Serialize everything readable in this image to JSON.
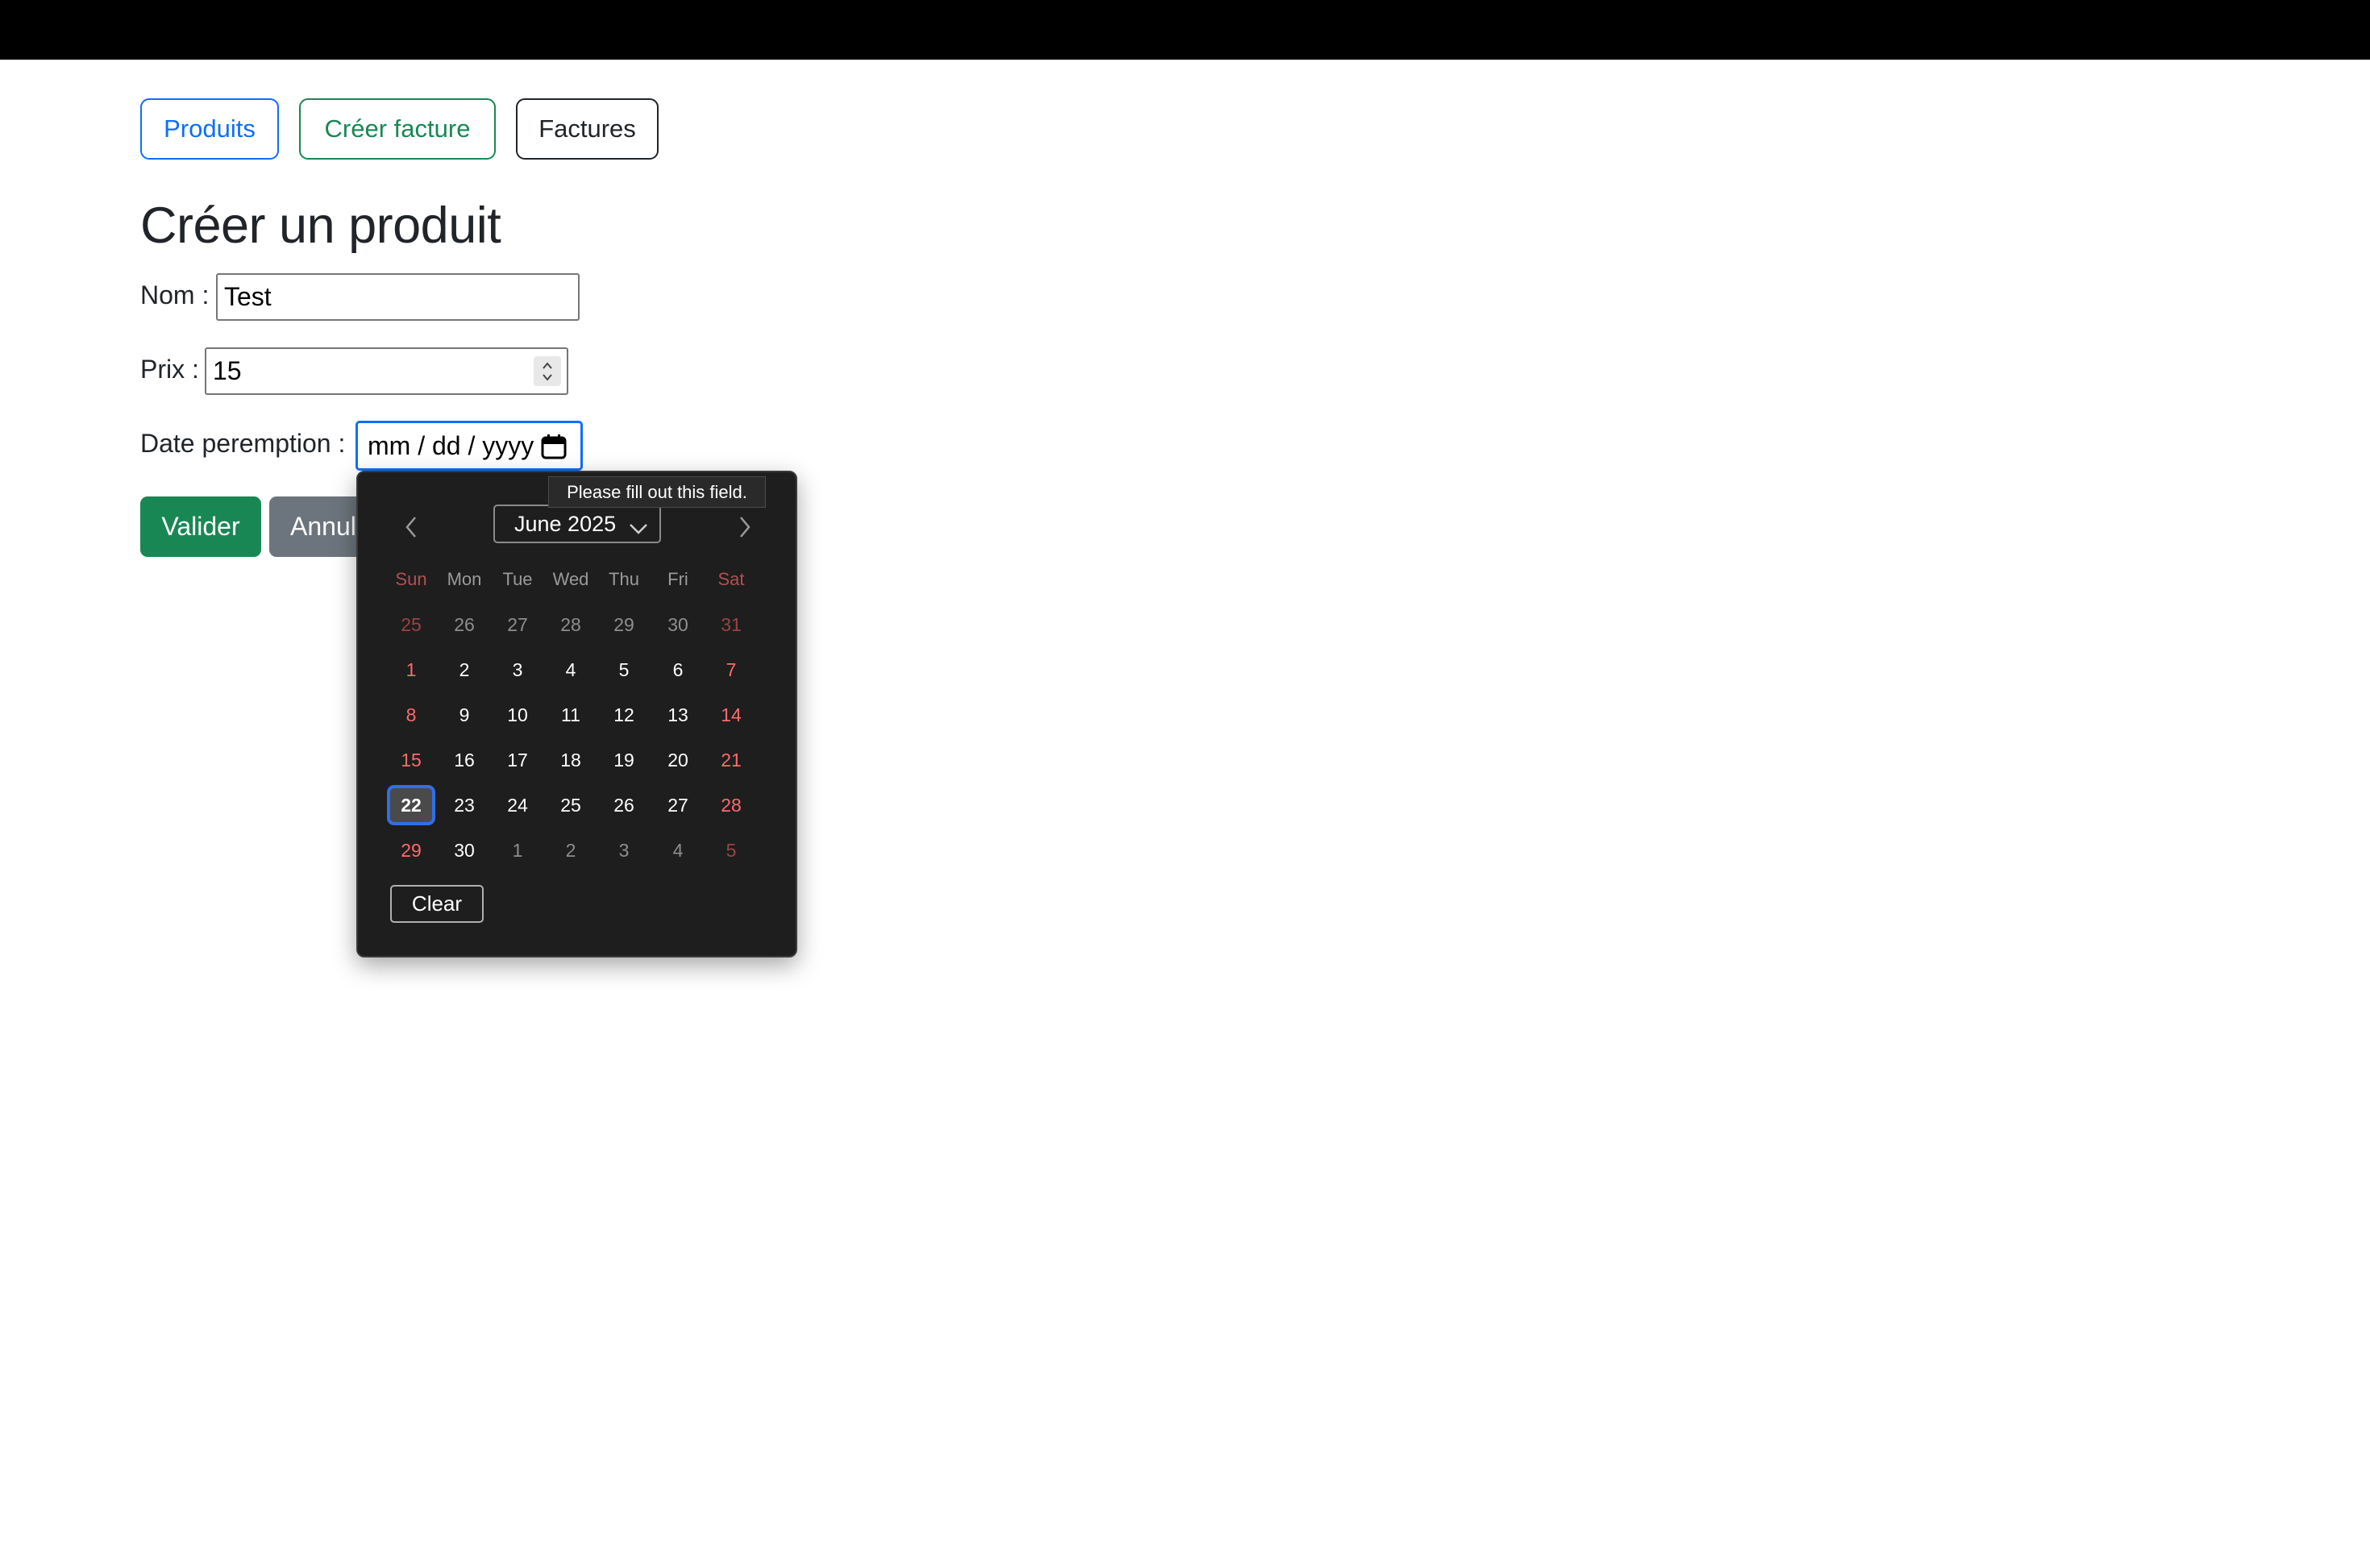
{
  "nav": {
    "produits_label": "Produits",
    "creer_facture_label": "Créer facture",
    "factures_label": "Factures"
  },
  "page": {
    "title": "Créer un produit"
  },
  "form": {
    "nom_label": "Nom :",
    "nom_value": "Test",
    "prix_label": "Prix :",
    "prix_value": "15",
    "date_label": "Date peremption :",
    "date_placeholder": "mm / dd / yyyy",
    "valider_label": "Valider",
    "annuler_label": "Annul"
  },
  "tooltip": {
    "text": "Please fill out this field."
  },
  "date_picker": {
    "month_label": "June 2025",
    "weekdays": [
      "Sun",
      "Mon",
      "Tue",
      "Wed",
      "Thu",
      "Fri",
      "Sat"
    ],
    "weeks": [
      [
        {
          "d": "25",
          "m": "prev"
        },
        {
          "d": "26",
          "m": "prev"
        },
        {
          "d": "27",
          "m": "prev"
        },
        {
          "d": "28",
          "m": "prev"
        },
        {
          "d": "29",
          "m": "prev"
        },
        {
          "d": "30",
          "m": "prev"
        },
        {
          "d": "31",
          "m": "prev"
        }
      ],
      [
        {
          "d": "1",
          "m": "cur"
        },
        {
          "d": "2",
          "m": "cur"
        },
        {
          "d": "3",
          "m": "cur"
        },
        {
          "d": "4",
          "m": "cur"
        },
        {
          "d": "5",
          "m": "cur"
        },
        {
          "d": "6",
          "m": "cur"
        },
        {
          "d": "7",
          "m": "cur"
        }
      ],
      [
        {
          "d": "8",
          "m": "cur"
        },
        {
          "d": "9",
          "m": "cur"
        },
        {
          "d": "10",
          "m": "cur"
        },
        {
          "d": "11",
          "m": "cur"
        },
        {
          "d": "12",
          "m": "cur"
        },
        {
          "d": "13",
          "m": "cur"
        },
        {
          "d": "14",
          "m": "cur"
        }
      ],
      [
        {
          "d": "15",
          "m": "cur"
        },
        {
          "d": "16",
          "m": "cur"
        },
        {
          "d": "17",
          "m": "cur"
        },
        {
          "d": "18",
          "m": "cur"
        },
        {
          "d": "19",
          "m": "cur"
        },
        {
          "d": "20",
          "m": "cur"
        },
        {
          "d": "21",
          "m": "cur"
        }
      ],
      [
        {
          "d": "22",
          "m": "cur",
          "selected": true
        },
        {
          "d": "23",
          "m": "cur"
        },
        {
          "d": "24",
          "m": "cur"
        },
        {
          "d": "25",
          "m": "cur"
        },
        {
          "d": "26",
          "m": "cur"
        },
        {
          "d": "27",
          "m": "cur"
        },
        {
          "d": "28",
          "m": "cur"
        }
      ],
      [
        {
          "d": "29",
          "m": "cur"
        },
        {
          "d": "30",
          "m": "cur"
        },
        {
          "d": "1",
          "m": "next"
        },
        {
          "d": "2",
          "m": "next"
        },
        {
          "d": "3",
          "m": "next"
        },
        {
          "d": "4",
          "m": "next"
        },
        {
          "d": "5",
          "m": "next"
        }
      ]
    ],
    "clear_label": "Clear"
  },
  "icons": {
    "calendar": "calendar-icon",
    "prev": "chevron-left-icon",
    "next": "chevron-right-icon",
    "dropdown": "chevron-down-icon",
    "spinner": "spinner-arrows-icon"
  },
  "colors": {
    "primary": "#0d6efd",
    "success": "#198754",
    "secondary": "#6c757d",
    "picker_bg": "#1e1e1e",
    "weekend": "#ff6b6b",
    "selected_ring": "#2f6fe8"
  }
}
